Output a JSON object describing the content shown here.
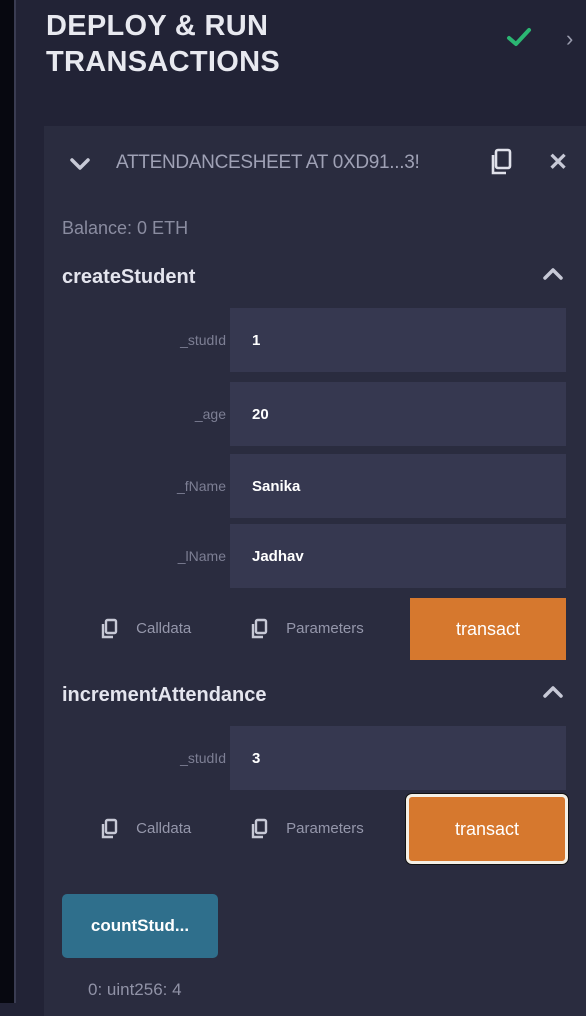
{
  "panel": {
    "title_line1": "DEPLOY & RUN",
    "title_line2": "TRANSACTIONS",
    "status_icon": "check-icon",
    "expand_icon": "chevron-right-icon",
    "colors": {
      "bg": "#222336",
      "card": "#2a2c3f",
      "accent": "#d6782e",
      "call": "#2f6f8c",
      "check": "#2bb673"
    }
  },
  "instance": {
    "title": "ATTENDANCESHEET AT 0XD91...3!",
    "balance": "Balance: 0 ETH"
  },
  "functions": [
    {
      "name": "createStudent",
      "params": [
        {
          "label": "_studId",
          "value": "1"
        },
        {
          "label": "_age",
          "value": "20"
        },
        {
          "label": "_fName",
          "value": "Sanika"
        },
        {
          "label": "_lName",
          "value": "Jadhav"
        }
      ],
      "calldata_label": "Calldata",
      "parameters_label": "Parameters",
      "button": "transact"
    },
    {
      "name": "incrementAttendance",
      "params": [
        {
          "label": "_studId",
          "value": "3"
        }
      ],
      "calldata_label": "Calldata",
      "parameters_label": "Parameters",
      "button": "transact"
    }
  ],
  "call": {
    "button": "countStud...",
    "result": "0: uint256: 4"
  }
}
